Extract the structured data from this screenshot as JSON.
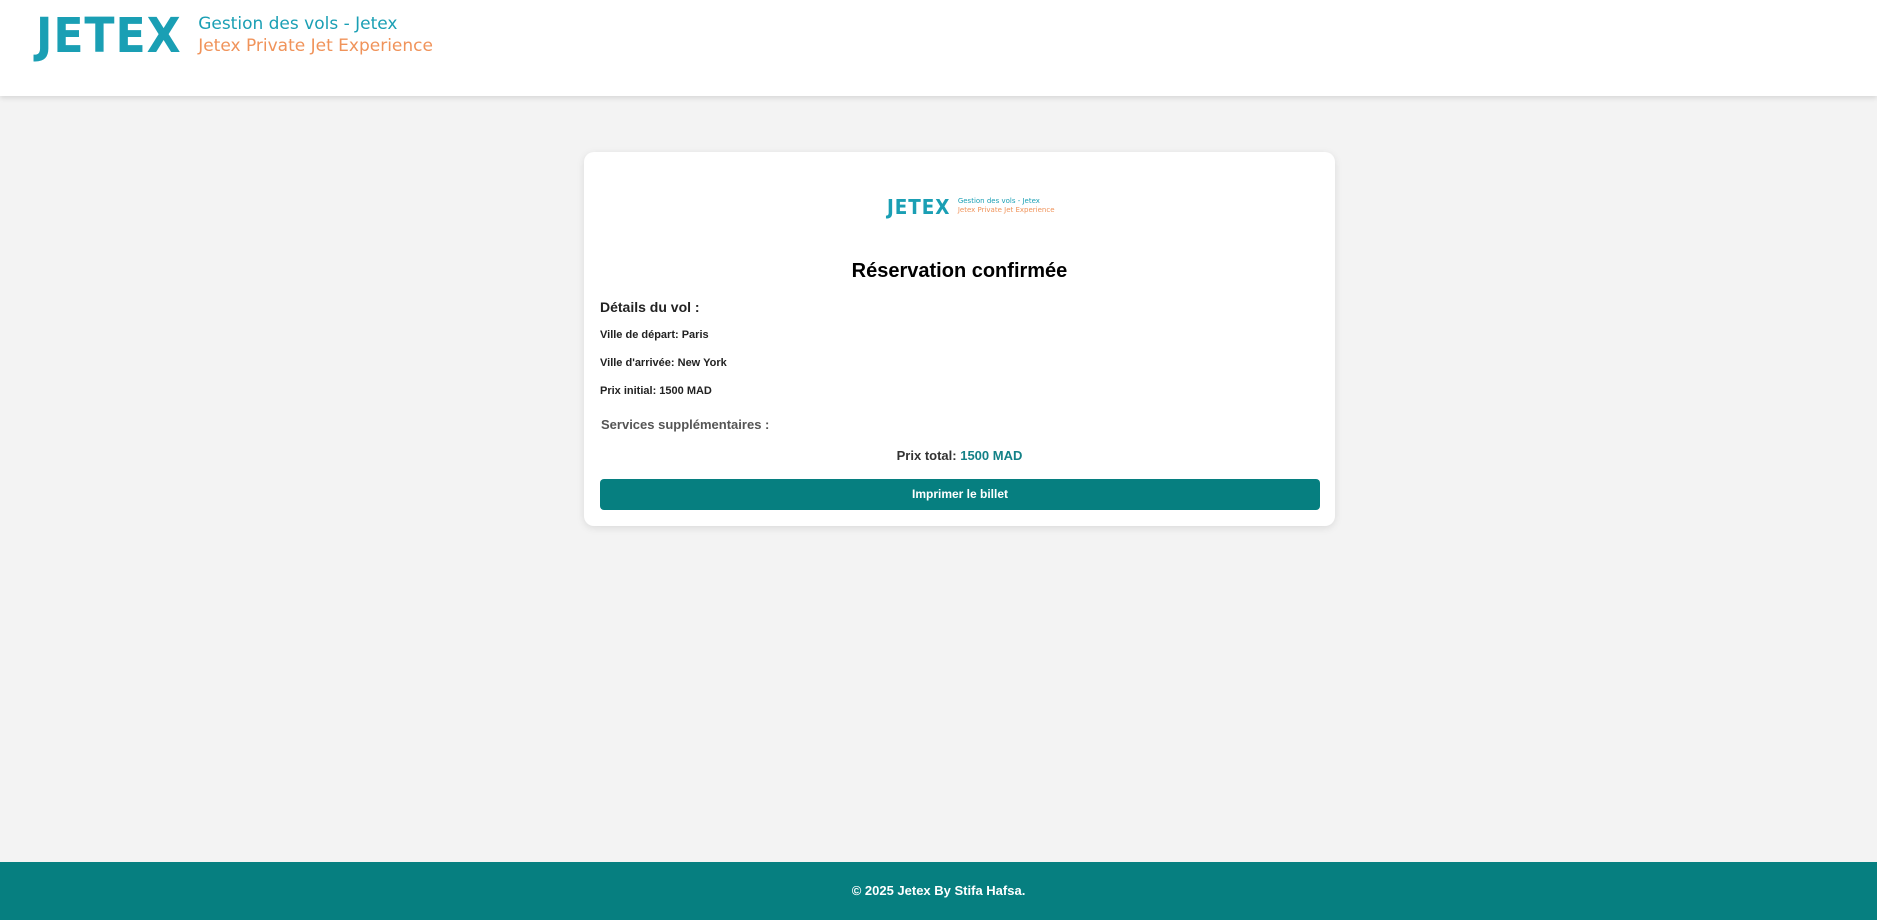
{
  "header": {
    "logo_mark": "JETEX",
    "logo_line1": "Gestion des vols - Jetex",
    "logo_line2": "Jetex Private Jet Experience"
  },
  "card": {
    "logo_mark": "JETEX",
    "logo_line1": "Gestion des vols - Jetex",
    "logo_line2": "Jetex Private Jet Experience",
    "title": "Réservation confirmée",
    "details_title": "Détails du vol :",
    "departure_label": "Ville de départ:",
    "departure_value": "Paris",
    "arrival_label": "Ville d'arrivée:",
    "arrival_value": "New York",
    "price_label": "Prix initial:",
    "price_value": "1500 MAD",
    "services_title": "Services supplémentaires :",
    "total_label": "Prix total:",
    "total_value": "1500 MAD",
    "print_button": "Imprimer le billet"
  },
  "footer": {
    "text": "© 2025 Jetex By Stifa Hafsa."
  },
  "colors": {
    "brand_teal": "#067f80",
    "logo_blue": "#1a9fb4",
    "logo_orange": "#f0935a"
  }
}
